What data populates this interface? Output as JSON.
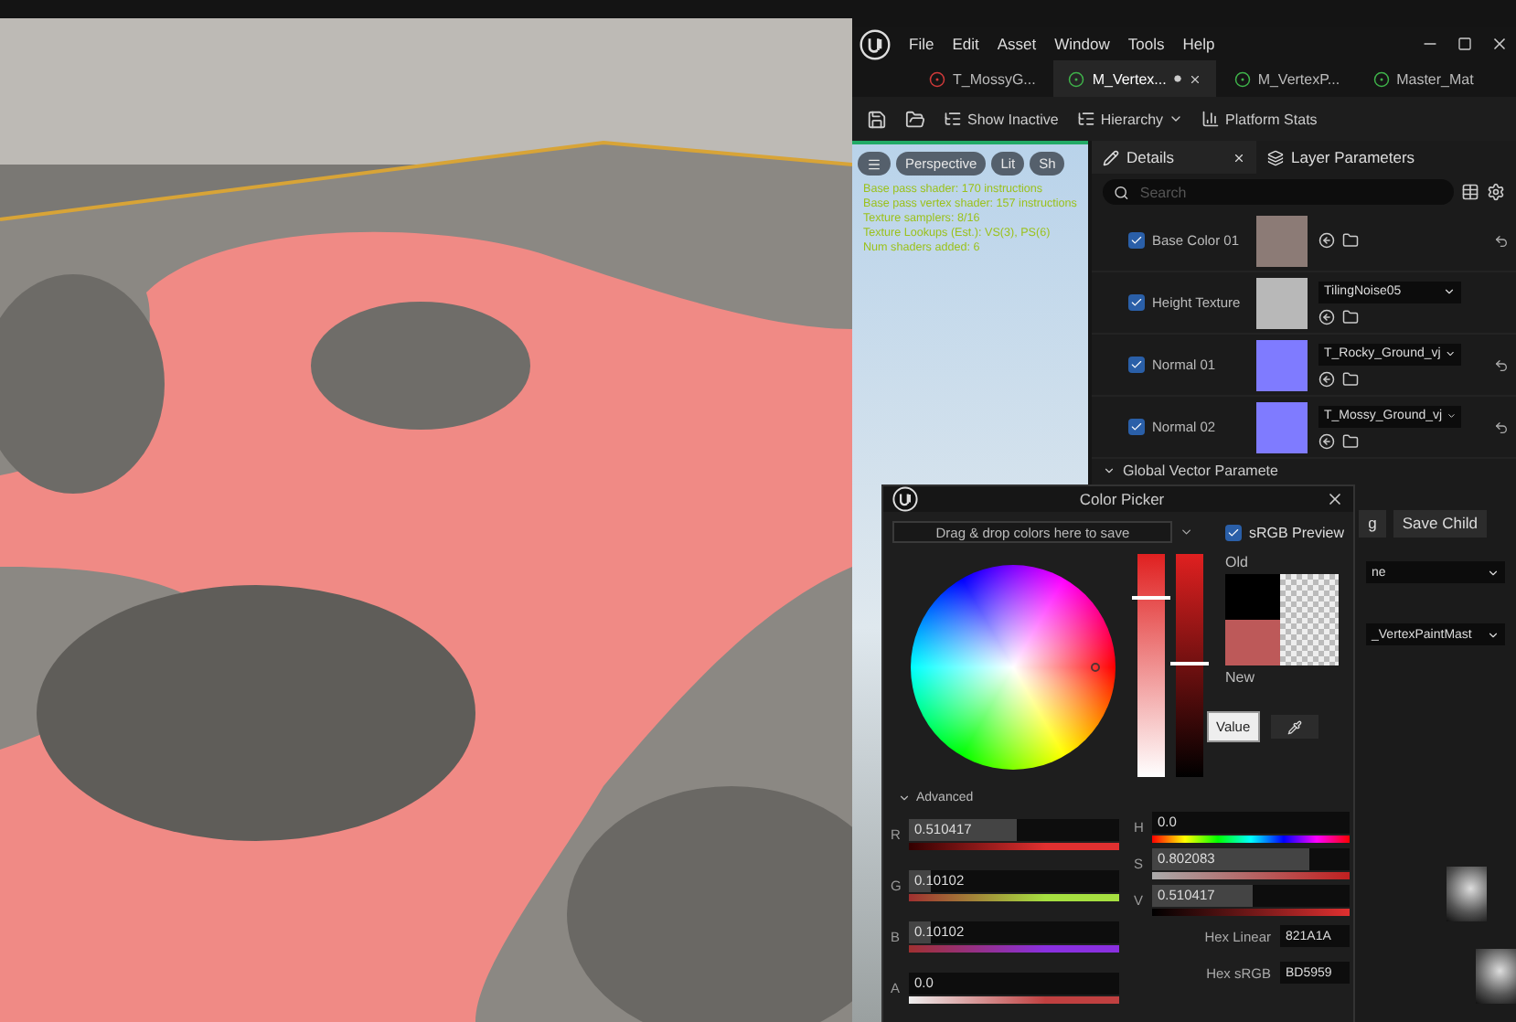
{
  "editor": {
    "menu": [
      "File",
      "Edit",
      "Asset",
      "Window",
      "Tools",
      "Help"
    ],
    "tabs": [
      {
        "label": "T_MossyG...",
        "selected": false,
        "color": "#d03a3a",
        "modified": false
      },
      {
        "label": "M_Vertex...",
        "selected": true,
        "color": "#3fb24a",
        "modified": true
      },
      {
        "label": "M_VertexP...",
        "selected": false,
        "color": "#3fb24a",
        "modified": false
      },
      {
        "label": "Master_Mat",
        "selected": false,
        "color": "#3fb24a",
        "modified": false
      }
    ],
    "toolbar": [
      {
        "label": "Show Inactive",
        "dropdown": false
      },
      {
        "label": "Hierarchy",
        "dropdown": true
      },
      {
        "label": "Platform Stats",
        "dropdown": false
      }
    ],
    "preview": {
      "view_buttons": [
        "Perspective",
        "Lit",
        "Sh"
      ],
      "stats": [
        "Base pass shader: 170 instructions",
        "Base pass vertex shader: 157 instructions",
        "Texture samplers: 8/16",
        "Texture Lookups (Est.): VS(3), PS(6)",
        "Num shaders added: 6"
      ]
    },
    "details": {
      "tabs": [
        {
          "label": "Details",
          "selected": true
        },
        {
          "label": "Layer Parameters",
          "selected": false
        }
      ],
      "search": {
        "placeholder": "Search"
      },
      "parameters": [
        {
          "name": "Base Color 01",
          "checked": true,
          "color": "#8c7b76",
          "reset": true
        },
        {
          "name": "Height Texture",
          "checked": true,
          "color": "#b8b8b8",
          "asset": "TilingNoise05",
          "reset": false
        },
        {
          "name": "Normal 01",
          "checked": true,
          "color": "#7f7bff",
          "asset": "T_Rocky_Ground_vj",
          "reset": true
        },
        {
          "name": "Normal 02",
          "checked": true,
          "color": "#7f7bff",
          "asset": "T_Mossy_Ground_vj",
          "reset": true
        }
      ],
      "group": "Global Vector Paramete",
      "buttons": [
        "g",
        "Save Child"
      ],
      "dropdowns": [
        "ne",
        "_VertexPaintMast"
      ]
    }
  },
  "color_picker": {
    "title": "Color Picker",
    "drop_hint": "Drag & drop colors here to save",
    "srgb_preview": {
      "label": "sRGB Preview",
      "checked": true
    },
    "swatches": [
      {
        "label": "Old",
        "color": "#000000"
      },
      {
        "label": "New",
        "color": "#bd5959"
      }
    ],
    "tooltip": "Value",
    "section": {
      "label": "Advanced",
      "expanded": true
    },
    "rgba": [
      {
        "label": "R",
        "value": "0.510417",
        "level": 0.51,
        "color": "#e03030"
      },
      {
        "label": "G",
        "value": "0.10102",
        "level": 0.1,
        "color": "#a6e040"
      },
      {
        "label": "B",
        "value": "0.10102",
        "level": 0.1,
        "color": "#8a30e0"
      },
      {
        "label": "A",
        "value": "0.0",
        "level": 0.0,
        "color": "#c04040"
      }
    ],
    "hsv": [
      {
        "label": "H",
        "value": "0.0",
        "level": 0.0
      },
      {
        "label": "S",
        "value": "0.802083",
        "level": 0.8
      },
      {
        "label": "V",
        "value": "0.510417",
        "level": 0.51
      }
    ],
    "hex": [
      {
        "label": "Hex Linear",
        "value": "821A1A"
      },
      {
        "label": "Hex sRGB",
        "value": "BD5959"
      }
    ]
  }
}
